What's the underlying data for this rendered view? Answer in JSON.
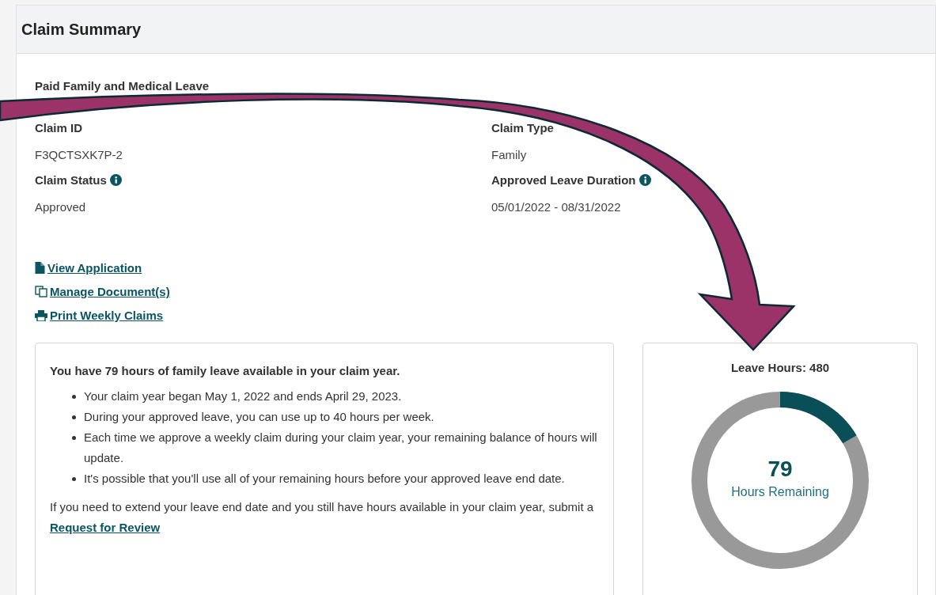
{
  "header": {
    "title": "Claim Summary"
  },
  "program": "Paid Family and Medical Leave",
  "details": [
    {
      "label": "Claim ID",
      "value": "F3QCTSXK7P-2",
      "info": false
    },
    {
      "label": "Claim Type",
      "value": "Family",
      "info": false
    },
    {
      "label": "Claim Status",
      "value": "Approved",
      "info": true
    },
    {
      "label": "Approved Leave Duration",
      "value": "05/01/2022 - 08/31/2022",
      "info": true
    }
  ],
  "links": [
    {
      "kind": "file",
      "label": "View Application"
    },
    {
      "kind": "copy",
      "label": "Manage Document(s)"
    },
    {
      "kind": "print",
      "label": "Print Weekly Claims"
    }
  ],
  "info_card": {
    "heading": "You have 79 hours of family leave available in your claim year.",
    "bullets": [
      "Your claim year began May 1, 2022 and ends April 29, 2023.",
      "During your approved leave, you can use up to 40 hours per week.",
      "Each time we approve a weekly claim during your claim year, your remaining balance of hours will update.",
      "It's possible that you'll use all of your remaining hours before your approved leave end date."
    ],
    "footer": "If you need to extend your leave end date and you still have hours available in your claim year, submit a",
    "footer_link": "Request for Review"
  },
  "hours_card": {
    "title": "Leave Hours: 480",
    "level": 0.165,
    "number": "79",
    "caption": "Hours Remaining"
  }
}
